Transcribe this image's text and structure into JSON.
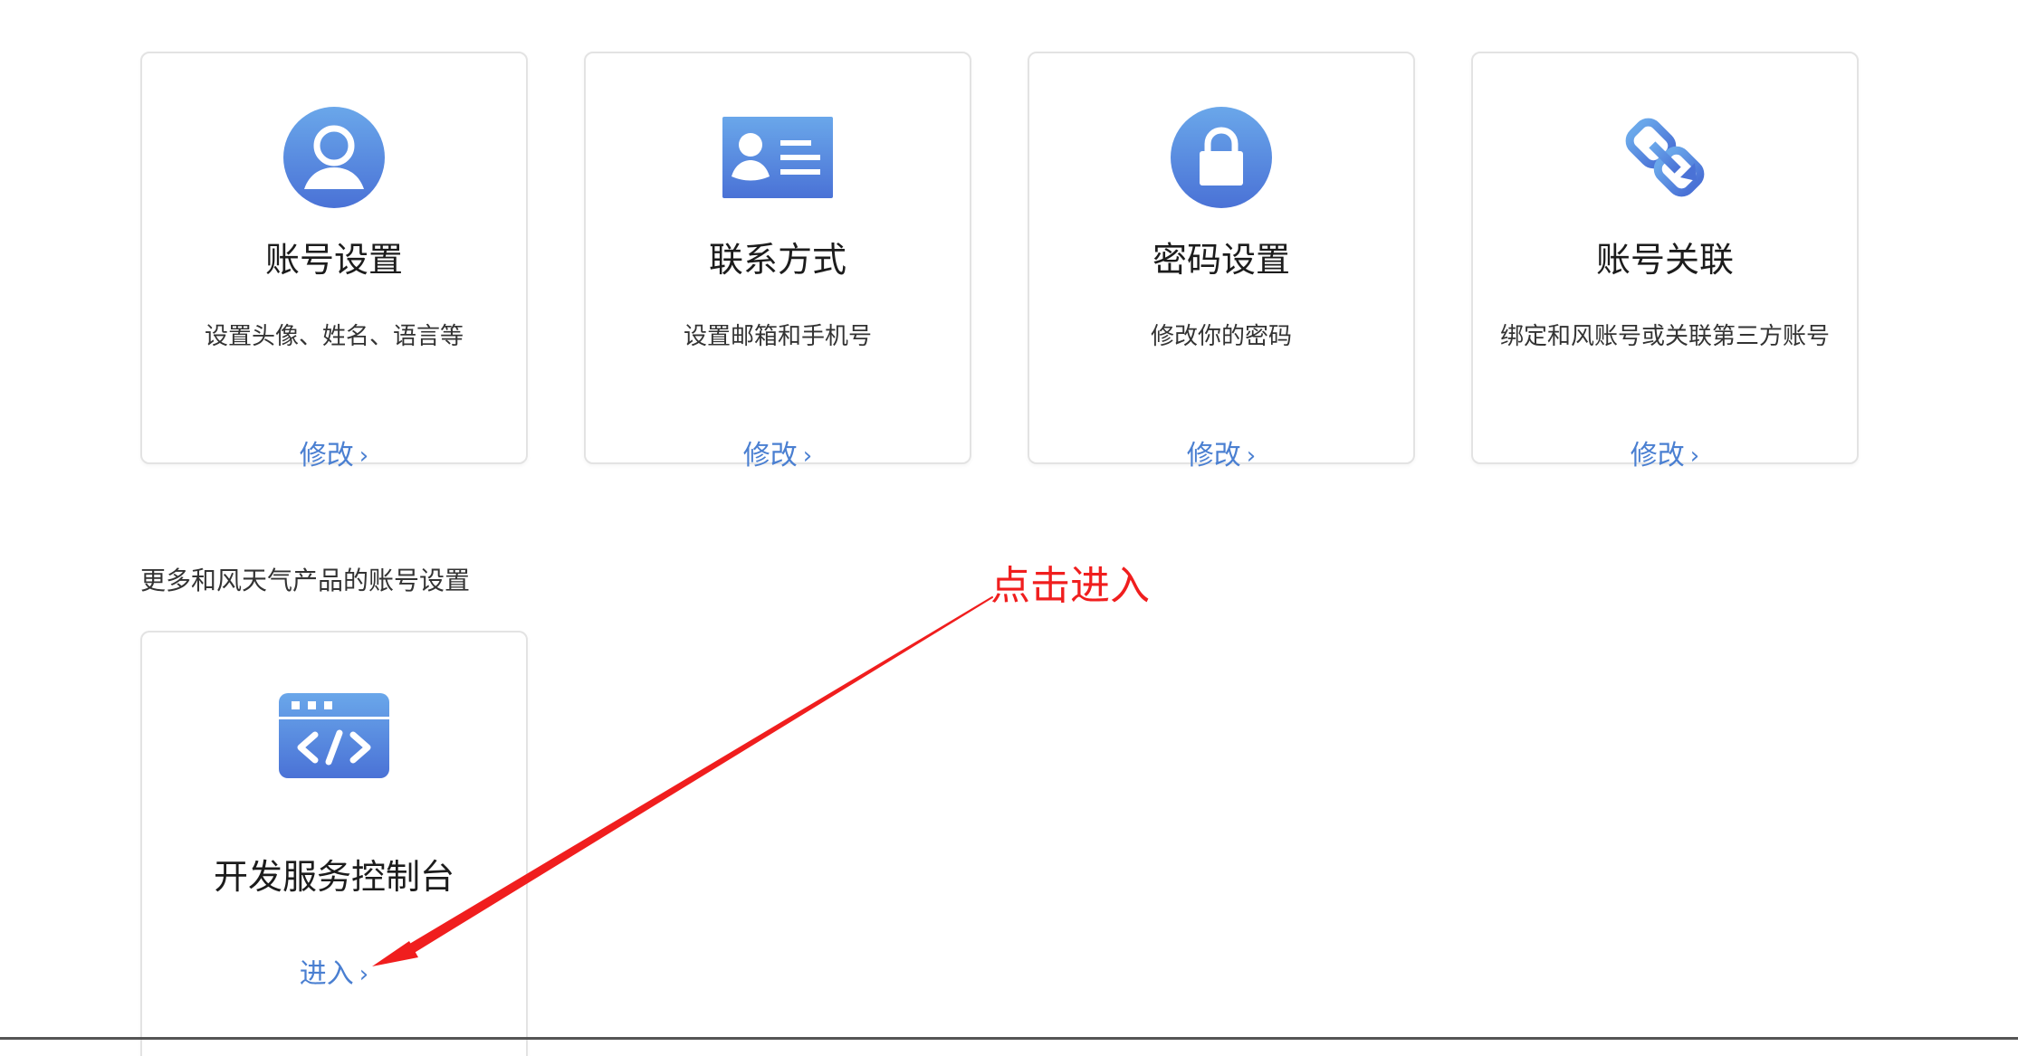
{
  "cards": [
    {
      "title": "账号设置",
      "desc": "设置头像、姓名、语言等",
      "action": "修改",
      "icon": "user-circle-icon"
    },
    {
      "title": "联系方式",
      "desc": "设置邮箱和手机号",
      "action": "修改",
      "icon": "contact-card-icon"
    },
    {
      "title": "密码设置",
      "desc": "修改你的密码",
      "action": "修改",
      "icon": "lock-icon"
    },
    {
      "title": "账号关联",
      "desc": "绑定和风账号或关联第三方账号",
      "action": "修改",
      "icon": "chain-link-icon"
    }
  ],
  "more_section": {
    "label": "更多和风天气产品的账号设置",
    "dev_card": {
      "title": "开发服务控制台",
      "action": "进入",
      "icon": "code-window-icon"
    }
  },
  "annotation": {
    "text": "点击进入",
    "color": "#f01e1e"
  },
  "colors": {
    "accent": "#4a7fd1",
    "icon_gradient_top": "#6aa7ea",
    "icon_gradient_bottom": "#4a72d6"
  }
}
